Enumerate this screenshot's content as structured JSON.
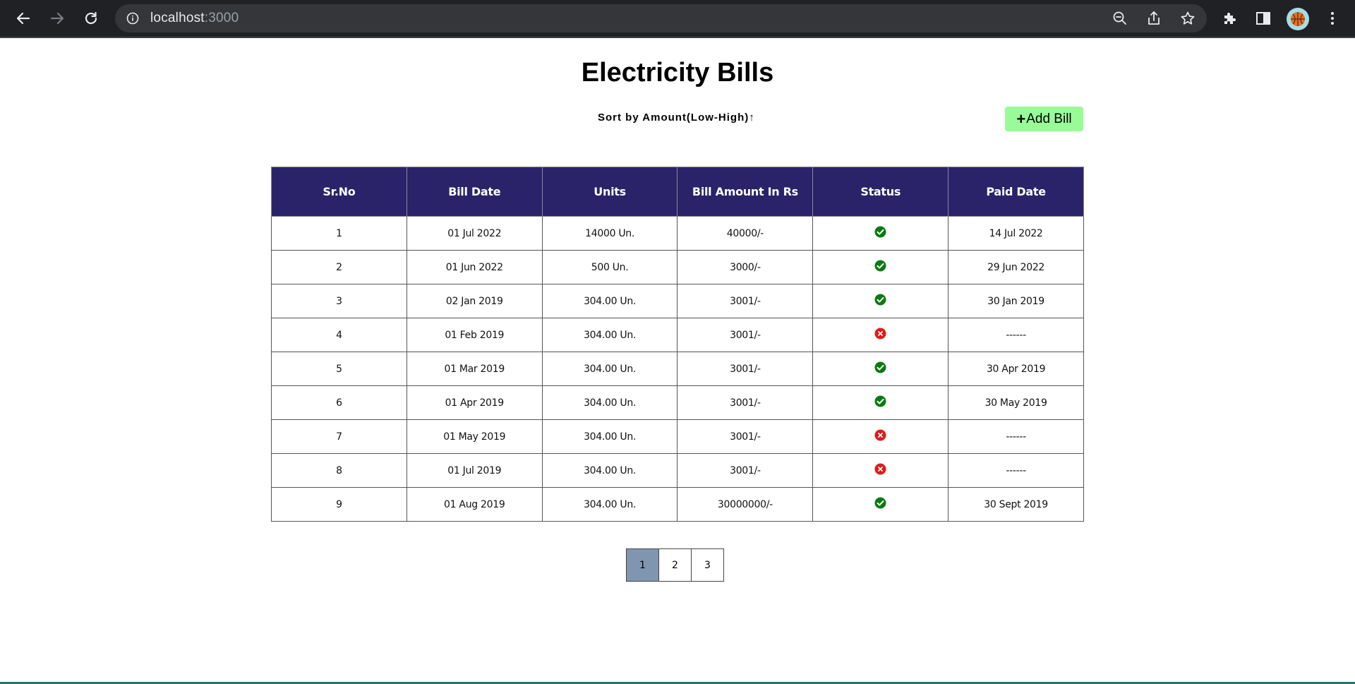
{
  "browser": {
    "url_host": "localhost",
    "url_port": ":3000"
  },
  "page": {
    "title": "Electricity Bills",
    "sort_label": "Sort by Amount(Low-High)",
    "sort_arrow": "↑",
    "add_plus": "+",
    "add_label": "Add Bill"
  },
  "table": {
    "headers": [
      "Sr.No",
      "Bill Date",
      "Units",
      "Bill Amount In Rs",
      "Status",
      "Paid Date"
    ],
    "rows": [
      {
        "sr": "1",
        "date": "01 Jul 2022",
        "units": "14000 Un.",
        "amount": "40000/-",
        "status": "paid",
        "paid": "14 Jul 2022"
      },
      {
        "sr": "2",
        "date": "01 Jun 2022",
        "units": "500 Un.",
        "amount": "3000/-",
        "status": "paid",
        "paid": "29 Jun 2022"
      },
      {
        "sr": "3",
        "date": "02 Jan 2019",
        "units": "304.00 Un.",
        "amount": "3001/-",
        "status": "paid",
        "paid": "30 Jan 2019"
      },
      {
        "sr": "4",
        "date": "01 Feb 2019",
        "units": "304.00 Un.",
        "amount": "3001/-",
        "status": "unpaid",
        "paid": "------"
      },
      {
        "sr": "5",
        "date": "01 Mar 2019",
        "units": "304.00 Un.",
        "amount": "3001/-",
        "status": "paid",
        "paid": "30 Apr 2019"
      },
      {
        "sr": "6",
        "date": "01 Apr 2019",
        "units": "304.00 Un.",
        "amount": "3001/-",
        "status": "paid",
        "paid": "30 May 2019"
      },
      {
        "sr": "7",
        "date": "01 May 2019",
        "units": "304.00 Un.",
        "amount": "3001/-",
        "status": "unpaid",
        "paid": "------"
      },
      {
        "sr": "8",
        "date": "01 Jul 2019",
        "units": "304.00 Un.",
        "amount": "3001/-",
        "status": "unpaid",
        "paid": "------"
      },
      {
        "sr": "9",
        "date": "01 Aug 2019",
        "units": "304.00 Un.",
        "amount": "30000000/-",
        "status": "paid",
        "paid": "30 Sept 2019"
      }
    ]
  },
  "pagination": {
    "pages": [
      "1",
      "2",
      "3"
    ],
    "active": "1"
  },
  "colors": {
    "header_bg": "#2a236a",
    "add_button_bg": "#98fb98",
    "paid_icon": "#0a7a12",
    "unpaid_icon": "#e01b1b",
    "active_page_bg": "#8096b0"
  },
  "icons": {
    "paid": "check-circle-icon",
    "unpaid": "x-circle-icon"
  }
}
